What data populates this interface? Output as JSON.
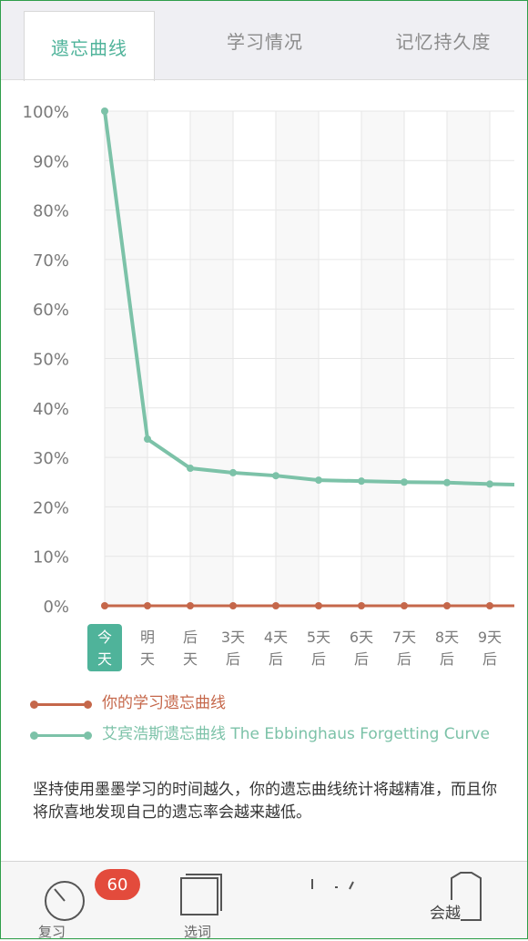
{
  "tabs": [
    {
      "label": "遗忘曲线",
      "active": true
    },
    {
      "label": "学习情况",
      "active": false
    },
    {
      "label": "记忆持久度",
      "active": false
    }
  ],
  "chart_data": {
    "type": "line",
    "y_ticks": [
      "100%",
      "90%",
      "80%",
      "70%",
      "60%",
      "50%",
      "40%",
      "30%",
      "20%",
      "10%",
      "0%"
    ],
    "ylim": [
      0,
      100
    ],
    "x_labels": [
      [
        "今",
        "天"
      ],
      [
        "明",
        "天"
      ],
      [
        "后",
        "天"
      ],
      [
        "3天",
        "后"
      ],
      [
        "4天",
        "后"
      ],
      [
        "5天",
        "后"
      ],
      [
        "6天",
        "后"
      ],
      [
        "7天",
        "后"
      ],
      [
        "8天",
        "后"
      ],
      [
        "9天",
        "后"
      ]
    ],
    "series": [
      {
        "name": "你的学习遗忘曲线",
        "color": "#c5674a",
        "values": [
          0,
          0,
          0,
          0,
          0,
          0,
          0,
          0,
          0,
          0,
          0
        ]
      },
      {
        "name": "艾宾浩斯遗忘曲线 The Ebbinghaus Forgetting Curve",
        "color": "#7cc2a8",
        "values": [
          100,
          33.7,
          27.8,
          26.9,
          26.3,
          25.4,
          25.2,
          25.0,
          24.9,
          24.6,
          24.5
        ]
      }
    ],
    "grid": true,
    "highlight_index": 0
  },
  "description": "坚持使用墨墨学习的时间越久，你的遗忘曲线统计将越精准，而且你将欣喜地发现自己的遗忘率会越来越低。",
  "bottom_nav": {
    "badge": "60",
    "review_label": "复习",
    "select_label": "选词",
    "more_label": "会越"
  }
}
